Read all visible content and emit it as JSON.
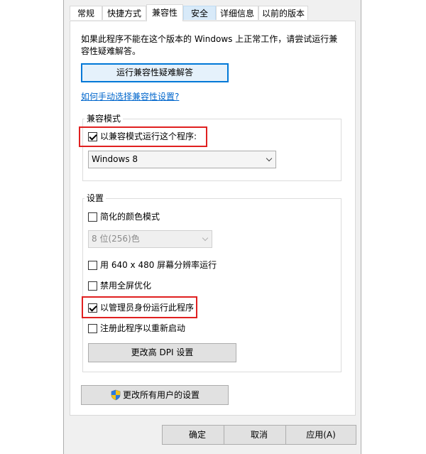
{
  "tabs": [
    {
      "label": "常规"
    },
    {
      "label": "快捷方式"
    },
    {
      "label": "兼容性"
    },
    {
      "label": "安全"
    },
    {
      "label": "详细信息"
    },
    {
      "label": "以前的版本"
    }
  ],
  "intro_text_line1": "如果此程序不能在这个版本的 Windows 上正常工作，请尝试运行兼",
  "intro_text_line2": "容性疑难解答。",
  "troubleshoot_button": "运行兼容性疑难解答",
  "manual_link": "如何手动选择兼容性设置?",
  "compat_mode": {
    "title": "兼容模式",
    "checkbox_label": "以兼容模式运行这个程序:",
    "checked": true,
    "selected_os": "Windows 8"
  },
  "settings": {
    "title": "设置",
    "reduced_color": {
      "label": "简化的颜色模式",
      "checked": false
    },
    "color_select": "8 位(256)色",
    "resolution_640": {
      "label": "用 640 x 480 屏幕分辨率运行",
      "checked": false
    },
    "disable_fullscreen_opt": {
      "label": "禁用全屏优化",
      "checked": false
    },
    "run_as_admin": {
      "label": "以管理员身份运行此程序",
      "checked": true
    },
    "register_restart": {
      "label": "注册此程序以重新启动",
      "checked": false
    },
    "dpi_button": "更改高 DPI 设置"
  },
  "all_users_button": "更改所有用户的设置",
  "footer": {
    "ok": "确定",
    "cancel": "取消",
    "apply": "应用(A)"
  },
  "colors": {
    "highlight_box": "#e02020",
    "link": "#0066cc",
    "focus": "#0078d7"
  }
}
